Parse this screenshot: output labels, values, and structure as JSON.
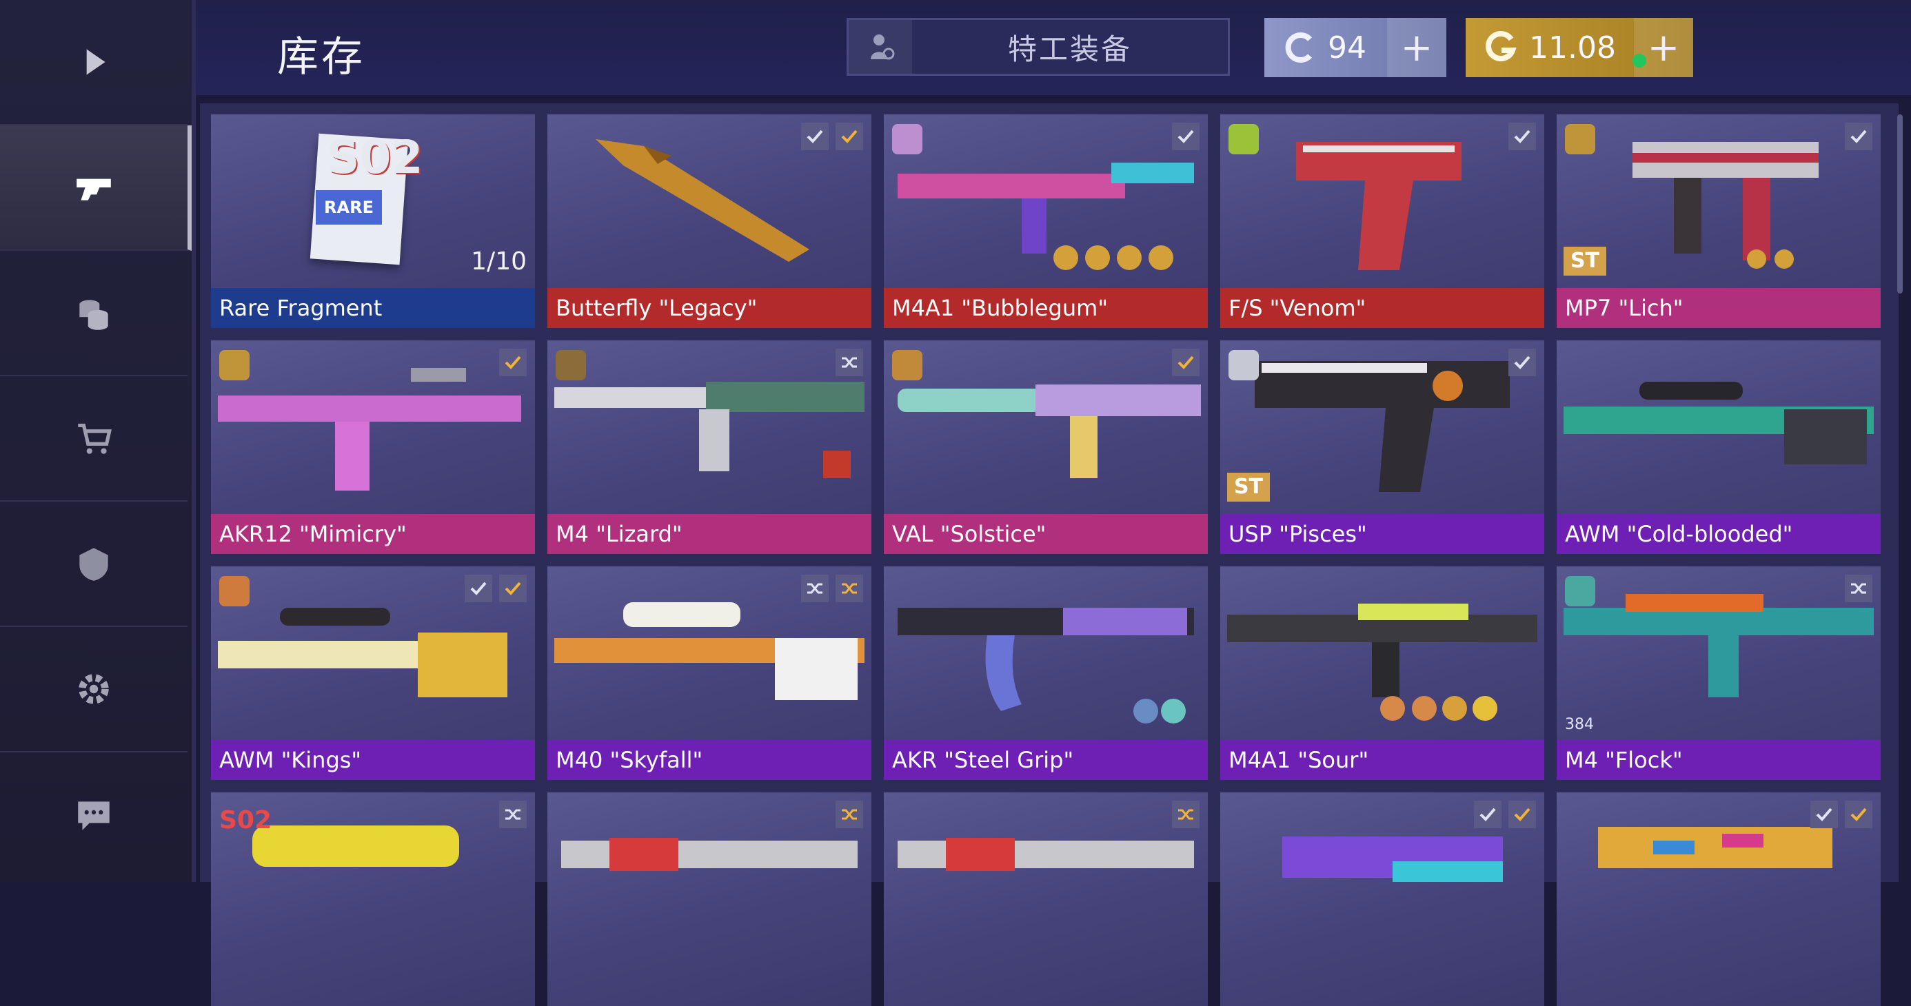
{
  "header": {
    "title": "库存",
    "agent_equipment_label": "特工装备",
    "silver_currency": {
      "value": "94",
      "icon": "silver-coin-icon",
      "add_label": "+"
    },
    "gold_currency": {
      "value": "11.08",
      "icon": "gold-coin-icon",
      "add_label": "+"
    }
  },
  "sidebar": {
    "items": [
      {
        "icon": "play-icon",
        "active": false
      },
      {
        "icon": "pistol-icon",
        "active": true
      },
      {
        "icon": "coins-icon",
        "active": false
      },
      {
        "icon": "cart-icon",
        "active": false
      },
      {
        "icon": "clan-shield-icon",
        "active": false
      },
      {
        "icon": "gear-icon",
        "active": false
      },
      {
        "icon": "chat-icon",
        "active": false
      }
    ]
  },
  "inventory": {
    "items": [
      {
        "name": "Rare Fragment",
        "rarity": "rare",
        "fragment_code": "S02",
        "fragment_tag": "RARE",
        "count": "1/10"
      },
      {
        "name": "Butterfly \"Legacy\"",
        "rarity": "legendary",
        "badges": [
          "check",
          "check-gold"
        ]
      },
      {
        "name": "M4A1 \"Bubblegum\"",
        "rarity": "legendary",
        "badges": [
          "check"
        ]
      },
      {
        "name": "F/S \"Venom\"",
        "rarity": "legendary",
        "badges": [
          "check"
        ]
      },
      {
        "name": "MP7 \"Lich\"",
        "rarity": "arcane",
        "badges": [
          "check"
        ],
        "stattrack": "ST"
      },
      {
        "name": "AKR12 \"Mimicry\"",
        "rarity": "arcane",
        "badges": [
          "check-gold"
        ]
      },
      {
        "name": "M4 \"Lizard\"",
        "rarity": "arcane",
        "badges": [
          "shuffle"
        ]
      },
      {
        "name": "VAL \"Solstice\"",
        "rarity": "arcane",
        "badges": [
          "check-gold"
        ]
      },
      {
        "name": "USP \"Pisces\"",
        "rarity": "epic",
        "badges": [
          "check"
        ],
        "stattrack": "ST"
      },
      {
        "name": "AWM \"Cold-blooded\"",
        "rarity": "epic",
        "badges": []
      },
      {
        "name": "AWM \"Kings\"",
        "rarity": "epic",
        "badges": [
          "check",
          "check-gold"
        ]
      },
      {
        "name": "M40 \"Skyfall\"",
        "rarity": "epic",
        "badges": [
          "shuffle",
          "shuffle-gold"
        ]
      },
      {
        "name": "AKR \"Steel Grip\"",
        "rarity": "epic",
        "badges": []
      },
      {
        "name": "M4A1 \"Sour\"",
        "rarity": "epic",
        "badges": []
      },
      {
        "name": "M4 \"Flock\"",
        "rarity": "epic",
        "badges": [
          "shuffle"
        ],
        "quantity": "384"
      },
      {
        "name": "",
        "rarity": "epic",
        "badges": [
          "shuffle"
        ],
        "fragment_code": "S02"
      },
      {
        "name": "",
        "rarity": "epic",
        "badges": [
          "shuffle-gold"
        ]
      },
      {
        "name": "",
        "rarity": "epic",
        "badges": [
          "shuffle-gold"
        ]
      },
      {
        "name": "",
        "rarity": "epic",
        "badges": [
          "check",
          "check-gold"
        ]
      },
      {
        "name": "",
        "rarity": "epic",
        "badges": [
          "check",
          "check-gold"
        ]
      }
    ]
  },
  "colors": {
    "rarity_rare": "#1e3c8e",
    "rarity_legendary": "#b22a2a",
    "rarity_arcane": "#b1307e",
    "rarity_epic": "#6e1fb4",
    "stattrack": "#d4a24a",
    "gold": "#c49a35",
    "silver": "#8e97c8"
  }
}
